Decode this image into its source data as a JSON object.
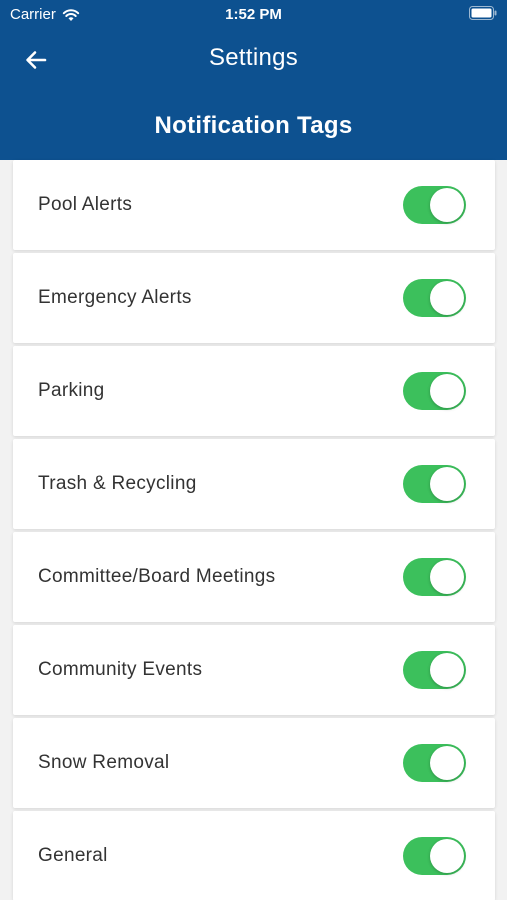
{
  "status_bar": {
    "carrier": "Carrier",
    "time": "1:52 PM",
    "wifi_icon": "wifi-icon",
    "battery_icon": "battery-icon"
  },
  "nav": {
    "back_icon": "arrow-left-icon",
    "title": "Settings"
  },
  "subtitle": "Notification Tags",
  "colors": {
    "header_bg": "#0d5190",
    "toggle_on": "#3cc05c",
    "page_bg": "#f2f2f2"
  },
  "tags": [
    {
      "label": "Pool Alerts",
      "enabled": true
    },
    {
      "label": "Emergency Alerts",
      "enabled": true
    },
    {
      "label": "Parking",
      "enabled": true
    },
    {
      "label": "Trash & Recycling",
      "enabled": true
    },
    {
      "label": "Committee/Board Meetings",
      "enabled": true
    },
    {
      "label": "Community Events",
      "enabled": true
    },
    {
      "label": "Snow Removal",
      "enabled": true
    },
    {
      "label": "General",
      "enabled": true
    }
  ]
}
